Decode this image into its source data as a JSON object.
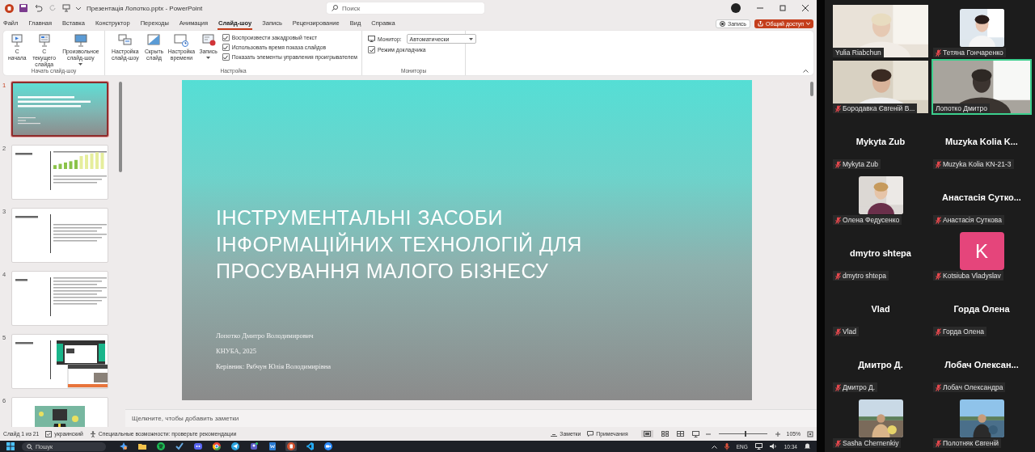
{
  "window": {
    "title": "Презентація Лопотко.pptx  -  PowerPoint"
  },
  "search": {
    "placeholder": "Поиск"
  },
  "ribbon_tabs": [
    {
      "label": "Файл",
      "selected": false
    },
    {
      "label": "Главная",
      "selected": false
    },
    {
      "label": "Вставка",
      "selected": false
    },
    {
      "label": "Конструктор",
      "selected": false
    },
    {
      "label": "Переходы",
      "selected": false
    },
    {
      "label": "Анимация",
      "selected": false
    },
    {
      "label": "Слайд-шоу",
      "selected": true
    },
    {
      "label": "Запись",
      "selected": false
    },
    {
      "label": "Рецензирование",
      "selected": false
    },
    {
      "label": "Вид",
      "selected": false
    },
    {
      "label": "Справка",
      "selected": false
    }
  ],
  "header_buttons": {
    "record": "Запись",
    "share": "Общий доступ"
  },
  "ribbon_groups": [
    {
      "label": "Начать слайд-шоу",
      "items": [
        {
          "kind": "button",
          "label": "С начала"
        },
        {
          "kind": "button",
          "label": "С текущего слайда"
        },
        {
          "kind": "dropdown",
          "label": "Произвольное слайд-шоу"
        }
      ]
    },
    {
      "label": "Настройка",
      "items": [
        {
          "kind": "button",
          "label": "Настройка слайд-шоу"
        },
        {
          "kind": "button",
          "label": "Скрыть слайд"
        },
        {
          "kind": "button",
          "label": "Настройка времени"
        },
        {
          "kind": "dropdown",
          "label": "Запись"
        },
        {
          "kind": "checkbox",
          "label": "Воспроизвести закадровый текст",
          "checked": true
        },
        {
          "kind": "checkbox",
          "label": "Использовать время показа слайдов",
          "checked": true
        },
        {
          "kind": "checkbox",
          "label": "Показать элементы управления проигрывателем",
          "checked": true
        }
      ]
    },
    {
      "label": "Мониторы",
      "items": [
        {
          "kind": "select",
          "label": "Монитор:",
          "value": "Автоматически"
        },
        {
          "kind": "checkbox",
          "label": "Режим докладчика",
          "checked": true
        }
      ]
    }
  ],
  "thumbnails": [
    {
      "number": "1",
      "kind": "cover",
      "selected": true
    },
    {
      "number": "2",
      "kind": "chart",
      "selected": false
    },
    {
      "number": "3",
      "kind": "text",
      "selected": false
    },
    {
      "number": "4",
      "kind": "list",
      "selected": false
    },
    {
      "number": "5",
      "kind": "screens",
      "selected": false
    },
    {
      "number": "6",
      "kind": "picture",
      "selected": false
    }
  ],
  "slide": {
    "title_lines": [
      "ІНСТРУМЕНТАЛЬНІ ЗАСОБИ",
      "ІНФОРМАЦІЙНИХ ТЕХНОЛОГІЙ ДЛЯ",
      "ПРОСУВАННЯ МАЛОГО БІЗНЕСУ"
    ],
    "author": "Лопотко Дмитро Володимирович",
    "org": "КНУБА, 2025",
    "supervisor": "Керівник: Рябчун Юлія Володимирівна"
  },
  "notes": {
    "placeholder": "Щелкните, чтобы добавить заметки"
  },
  "status_bar": {
    "slide": "Слайд 1 из 21",
    "language": "украинский",
    "accessibility": "Специальные возможности: проверьте рекомендации",
    "notes": "Заметки",
    "comments": "Примечания",
    "zoom": "105%",
    "zoom_slider": {
      "level": 0.55
    }
  },
  "taskbar": {
    "search": {
      "placeholder": "Пошук"
    },
    "apps": [
      {
        "selected": false
      },
      {
        "selected": false
      },
      {
        "selected": false
      },
      {
        "selected": false
      },
      {
        "selected": false
      },
      {
        "selected": false
      },
      {
        "selected": false
      },
      {
        "selected": false
      },
      {
        "selected": false
      },
      {
        "selected": true
      },
      {
        "selected": false
      },
      {
        "selected": false
      }
    ],
    "language": "ENG",
    "time": "10:34"
  },
  "participants": [
    {
      "name": "Yulia Riabchun",
      "kind": "video",
      "muted": false,
      "speaking": false
    },
    {
      "name": "Тетяна Гончаренко",
      "muted": true,
      "speaking": false
    },
    {
      "name": "Бородавка Євгеній В...",
      "kind": "video",
      "muted": true,
      "speaking": false
    },
    {
      "name": "Лопотко Дмитро",
      "kind": "video",
      "muted": false,
      "speaking": true
    },
    {
      "name": "Mykyta Zub",
      "kind": "name",
      "display_name": "Mykyta Zub",
      "muted": true,
      "speaking": false
    },
    {
      "name": "Muzyka Kolia KN-21-3",
      "kind": "name",
      "display_name": "Muzyka Kolia K...",
      "muted": true,
      "speaking": false
    },
    {
      "name": "Олена Федусенко",
      "muted": true,
      "speaking": false
    },
    {
      "name": "Анастасія Суткова",
      "kind": "name",
      "display_name": "Анастасія Сутко...",
      "muted": true,
      "speaking": false
    },
    {
      "name": "dmytro shtepa",
      "kind": "name",
      "display_name": "dmytro shtepa",
      "muted": true,
      "speaking": false
    },
    {
      "name": "Kotsiuba Vladyslav",
      "kind": "letter",
      "letter": "K",
      "color": "#e5457b",
      "muted": true,
      "speaking": false
    },
    {
      "name": "Vlad",
      "kind": "name",
      "display_name": "Vlad",
      "muted": true,
      "speaking": false
    },
    {
      "name": "Горда Олена",
      "kind": "name",
      "display_name": "Горда Олена",
      "muted": true,
      "speaking": false
    },
    {
      "name": "Дмитро Д.",
      "kind": "name",
      "display_name": "Дмитро Д.",
      "muted": true,
      "speaking": false
    },
    {
      "name": "Лобач Олександра",
      "kind": "name",
      "display_name": "Лобач Олексан...",
      "muted": true,
      "speaking": false
    },
    {
      "name": "Sasha Chernenkiy",
      "muted": true,
      "speaking": false
    },
    {
      "name": "Полотняк Євгеній",
      "muted": true,
      "speaking": false
    }
  ]
}
